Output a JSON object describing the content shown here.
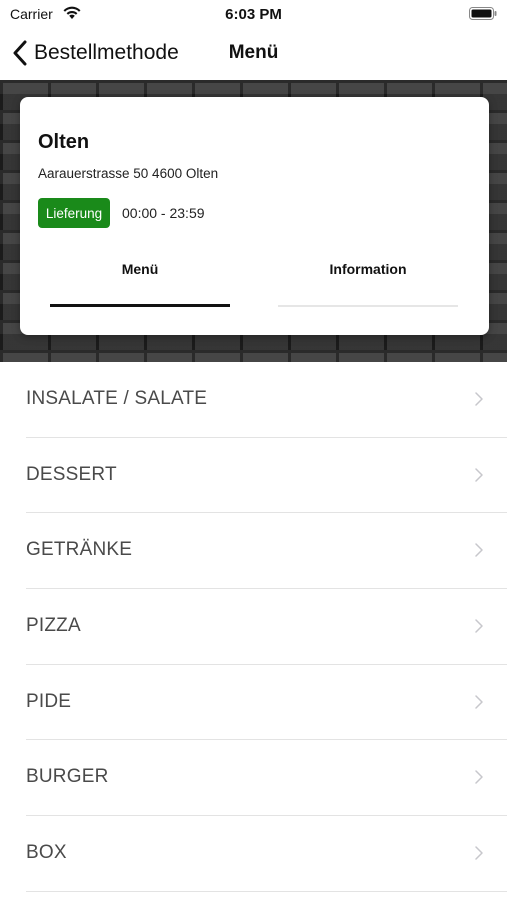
{
  "status_bar": {
    "carrier": "Carrier",
    "time": "6:03 PM"
  },
  "nav": {
    "back_label": "Bestellmethode",
    "title": "Menü"
  },
  "store": {
    "name": "Olten",
    "address": "Aarauerstrasse 50 4600 Olten",
    "delivery_badge": "Lieferung",
    "hours": "00:00 - 23:59",
    "badge_color": "#1a8a1a"
  },
  "tabs": [
    {
      "label": "Menü",
      "active": true
    },
    {
      "label": "Information",
      "active": false
    }
  ],
  "categories": [
    {
      "label": "INSALATE / SALATE"
    },
    {
      "label": "DESSERT"
    },
    {
      "label": "GETRÄNKE"
    },
    {
      "label": "PIZZA"
    },
    {
      "label": "PIDE"
    },
    {
      "label": "BURGER"
    },
    {
      "label": "BOX"
    }
  ]
}
